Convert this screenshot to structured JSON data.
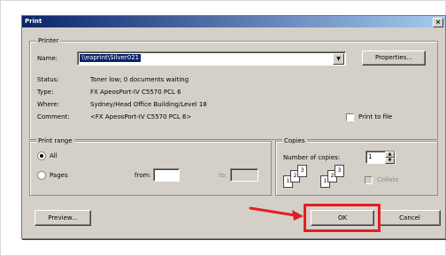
{
  "window": {
    "title": "Print",
    "close_glyph": "×"
  },
  "printer": {
    "group_label": "Printer",
    "name_label": "Name:",
    "name_value": "\\\\eaprint\\Silver021",
    "properties_label": "Properties...",
    "status_label": "Status:",
    "status_value": "Toner low; 0 documents waiting",
    "type_label": "Type:",
    "type_value": "FX ApeosPort-IV C5570 PCL 6",
    "where_label": "Where:",
    "where_value": "Sydney/Head Office Building/Level 18",
    "comment_label": "Comment:",
    "comment_value": "<FX ApeosPort-IV C5570 PCL 6>",
    "print_to_file_label": "Print to file"
  },
  "print_range": {
    "group_label": "Print range",
    "all_label": "All",
    "pages_label": "Pages",
    "from_label": "from:",
    "to_label": "to:",
    "from_value": "",
    "to_value": ""
  },
  "copies": {
    "group_label": "Copies",
    "number_label": "Number of copies:",
    "number_value": "1",
    "collate_label": "Collate"
  },
  "buttons": {
    "preview": "Preview...",
    "ok": "OK",
    "cancel": "Cancel"
  },
  "colors": {
    "highlight": "#e02020",
    "titlebar": "#0a246a"
  }
}
